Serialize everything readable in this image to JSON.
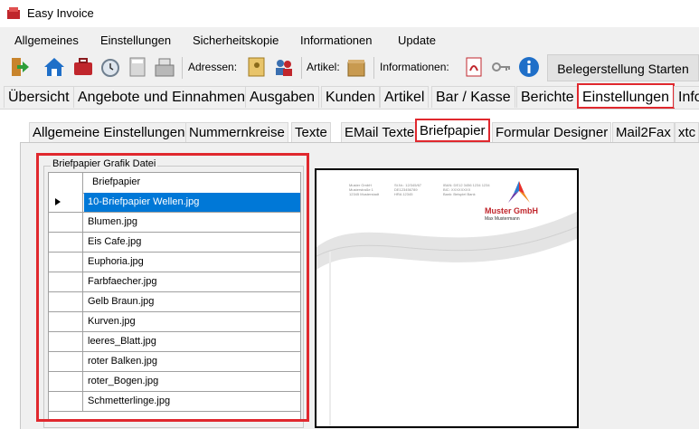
{
  "window": {
    "title": "Easy Invoice"
  },
  "menu": [
    "Allgemeines",
    "Einstellungen",
    "Sicherheitskopie",
    "Informationen",
    "Update"
  ],
  "toolbar": {
    "adressen_label": "Adressen:",
    "artikel_label": "Artikel:",
    "informationen_label": "Informationen:",
    "beleg_button": "Belegerstellung Starten"
  },
  "main_tabs": [
    "Übersicht",
    "Angebote und Einnahmen",
    "Ausgaben",
    "Kunden",
    "Artikel",
    "Bar / Kasse",
    "Berichte",
    "Einstellungen",
    "Info"
  ],
  "sub_tabs": [
    "Allgemeine Einstellungen",
    "Nummernkreise",
    "Texte",
    "EMail Texte",
    "Briefpapier",
    "Formular Designer",
    "Mail2Fax",
    "xtc"
  ],
  "group": {
    "legend": "Briefpapier Grafik Datei",
    "column_header": "Briefpapier",
    "files": [
      "10-Briefpapier Wellen.jpg",
      "Blumen.jpg",
      "Eis Cafe.jpg",
      "Euphoria.jpg",
      "Farbfaecher.jpg",
      "Gelb Braun.jpg",
      "Kurven.jpg",
      "leeres_Blatt.jpg",
      "roter Balken.jpg",
      "roter_Bogen.jpg",
      "Schmetterlinge.jpg"
    ],
    "selected_index": 0
  },
  "preview": {
    "company": "Muster GmbH",
    "person": "Max Mustermann"
  },
  "colors": {
    "accent": "#e0282e",
    "selection": "#0078d7"
  }
}
